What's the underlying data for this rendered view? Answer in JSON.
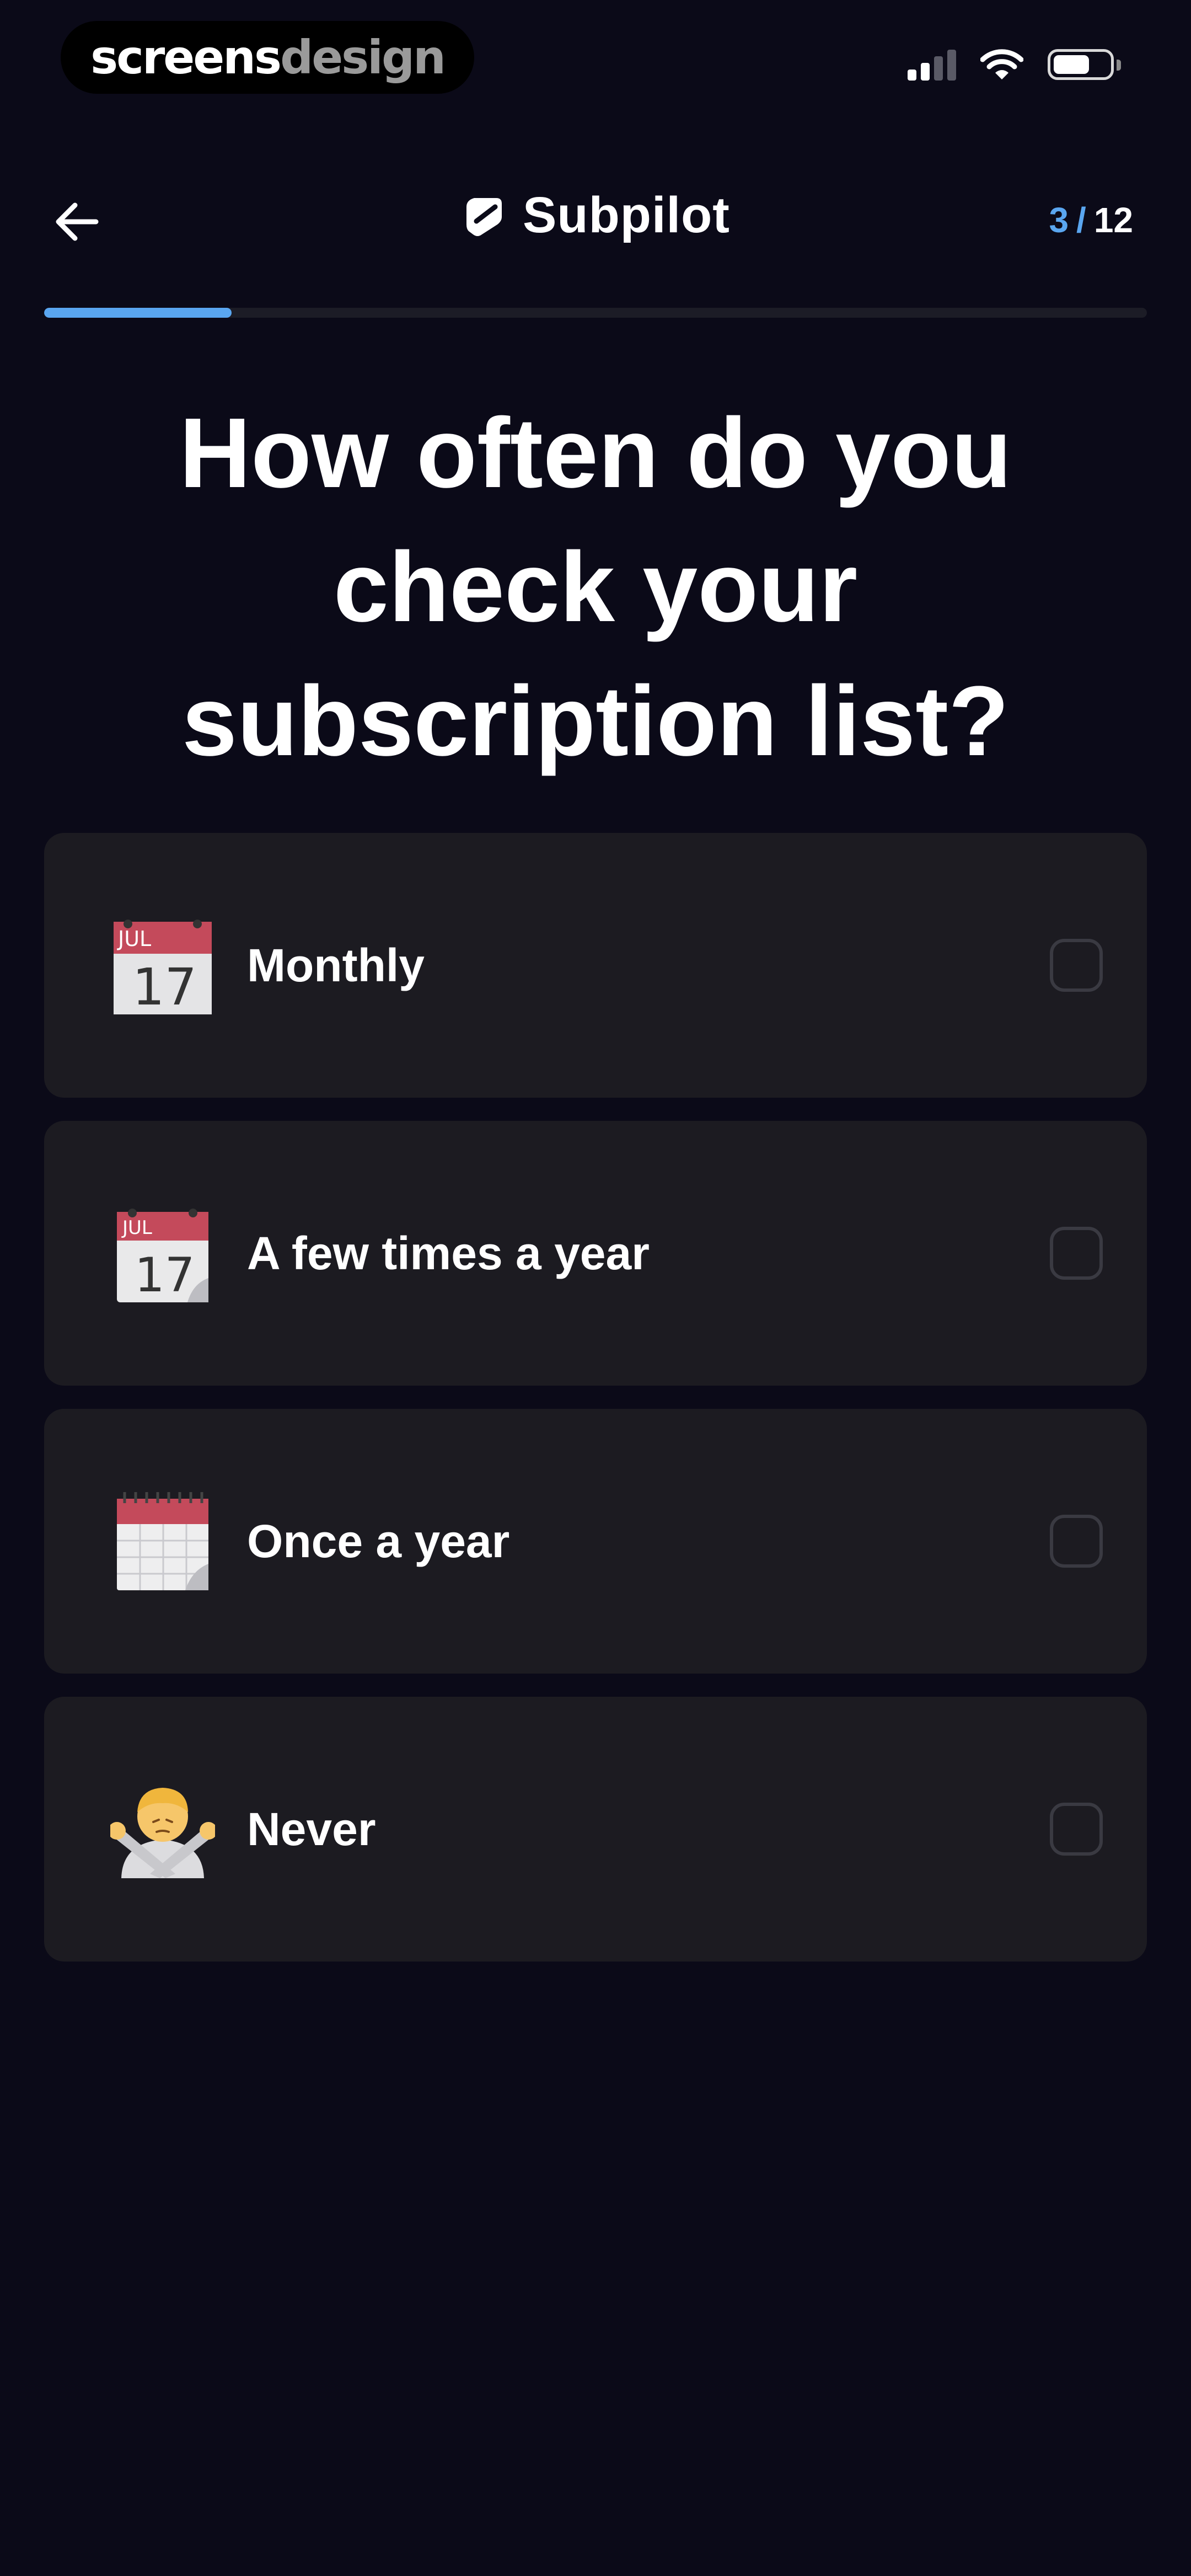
{
  "status_bar": {
    "watermark_primary": "screens",
    "watermark_secondary": "design",
    "icons": [
      "cellular-signal-icon",
      "wifi-icon",
      "battery-icon"
    ]
  },
  "header": {
    "back_icon": "arrow-left-icon",
    "logo_icon": "subpilot-logo-icon",
    "title": "Subpilot",
    "step_current": "3",
    "step_separator": "/",
    "step_total": "12"
  },
  "progress": {
    "value": 3,
    "max": 12,
    "fill_fraction": 0.17,
    "color": "#5aa6f0"
  },
  "question": {
    "text": "How often do you check your subscription list?"
  },
  "options": [
    {
      "label": "Monthly",
      "emoji": "calendar-icon",
      "selected": false
    },
    {
      "label": "A few times a year",
      "emoji": "tear-off-calendar-icon",
      "selected": false
    },
    {
      "label": "Once a year",
      "emoji": "spiral-calendar-icon",
      "selected": false
    },
    {
      "label": "Never",
      "emoji": "person-gesturing-no-icon",
      "selected": false
    }
  ],
  "colors": {
    "background": "#0b0a18",
    "card": "#1c1b21",
    "accent": "#5aa6f0",
    "checkbox_border": "#3a3a42"
  }
}
